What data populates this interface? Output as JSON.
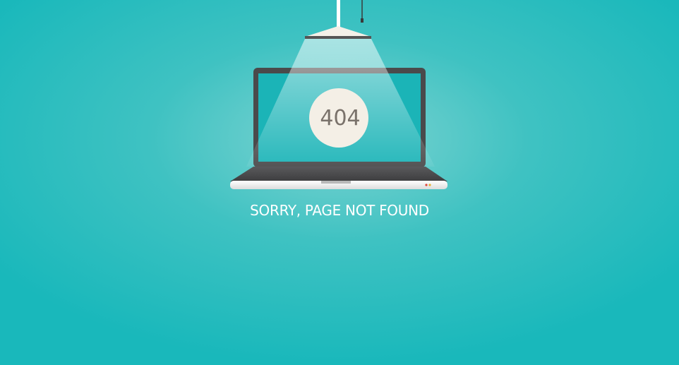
{
  "page": {
    "error_code": "404",
    "message": "SORRY, PAGE NOT FOUND"
  },
  "colors": {
    "background": "#19b8bb",
    "background_glow": "#7fd4d2",
    "laptop_bezel": "#4a4a4b",
    "laptop_screen": "#1bb4b7",
    "laptop_base": "#f1f1f1",
    "badge": "#f4efe6",
    "error_code_text": "#7a726b",
    "message_text": "#ffffff"
  },
  "icons": {
    "lamp": "ceiling-lamp-icon",
    "laptop": "laptop-icon"
  }
}
